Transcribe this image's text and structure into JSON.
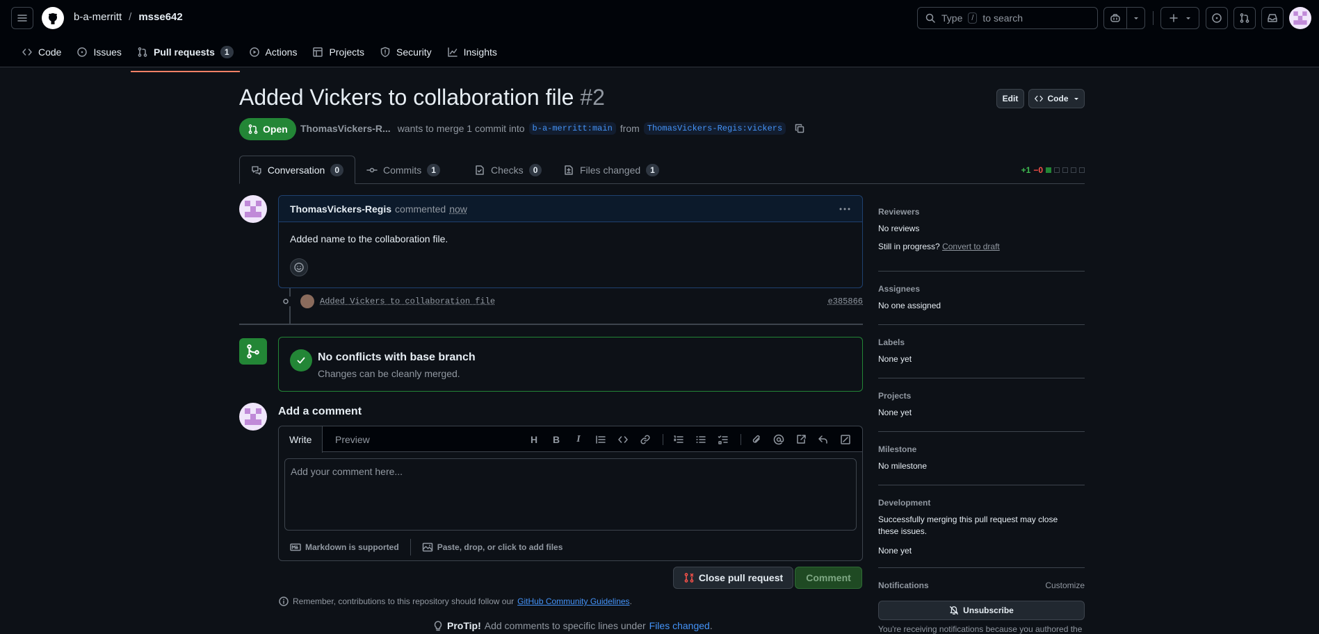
{
  "header": {
    "owner": "b-a-merritt",
    "separator": "/",
    "repo": "msse642",
    "search_placeholder": "Type",
    "search_key": "/",
    "search_suffix": "to search"
  },
  "repo_nav": [
    {
      "label": "Code",
      "icon": "code-icon"
    },
    {
      "label": "Issues",
      "icon": "issue-icon"
    },
    {
      "label": "Pull requests",
      "icon": "pull-request-icon",
      "count": "1",
      "active": true
    },
    {
      "label": "Actions",
      "icon": "play-icon"
    },
    {
      "label": "Projects",
      "icon": "table-icon"
    },
    {
      "label": "Security",
      "icon": "shield-icon"
    },
    {
      "label": "Insights",
      "icon": "graph-icon"
    }
  ],
  "pr": {
    "title": "Added Vickers to collaboration file",
    "number": "#2",
    "edit_label": "Edit",
    "code_label": "Code",
    "state": "Open",
    "author_short": "ThomasVickers-R...",
    "merge_text": "wants to merge 1 commit into",
    "base_branch": "b-a-merritt:main",
    "from_text": "from",
    "head_branch": "ThomasVickers-Regis:vickers"
  },
  "tabs": {
    "conversation": {
      "label": "Conversation",
      "count": "0"
    },
    "commits": {
      "label": "Commits",
      "count": "1"
    },
    "checks": {
      "label": "Checks",
      "count": "0"
    },
    "files": {
      "label": "Files changed",
      "count": "1"
    }
  },
  "diffstat": {
    "add": "+1",
    "del": "−0"
  },
  "comment": {
    "author": "ThomasVickers-Regis",
    "action": "commented",
    "time": "now",
    "body": "Added name to the collaboration file."
  },
  "commit": {
    "message": "Added Vickers to collaboration file",
    "sha": "e385866"
  },
  "merge": {
    "title": "No conflicts with base branch",
    "subtitle": "Changes can be cleanly merged."
  },
  "editor": {
    "heading": "Add a comment",
    "write_tab": "Write",
    "preview_tab": "Preview",
    "placeholder": "Add your comment here...",
    "markdown": "Markdown is supported",
    "attach": "Paste, drop, or click to add files"
  },
  "actions": {
    "close": "Close pull request",
    "comment": "Comment"
  },
  "footer": {
    "remember": "Remember, contributions to this repository should follow our",
    "guidelines": "GitHub Community Guidelines",
    "period": ".",
    "protip_label": "ProTip!",
    "protip_text": "Add comments to specific lines under",
    "protip_link": "Files changed",
    "protip_end": "."
  },
  "sidebar": {
    "reviewers": {
      "label": "Reviewers",
      "value": "No reviews",
      "progress": "Still in progress?",
      "draft_link": "Convert to draft"
    },
    "assignees": {
      "label": "Assignees",
      "value": "No one assigned"
    },
    "labels": {
      "label": "Labels",
      "value": "None yet"
    },
    "projects": {
      "label": "Projects",
      "value": "None yet"
    },
    "milestone": {
      "label": "Milestone",
      "value": "No milestone"
    },
    "development": {
      "label": "Development",
      "text": "Successfully merging this pull request may close these issues.",
      "value": "None yet"
    },
    "notifications": {
      "label": "Notifications",
      "customize": "Customize",
      "unsubscribe": "Unsubscribe",
      "reason": "You're receiving notifications because you authored the"
    }
  },
  "colors": {
    "accent": "#4493f8",
    "success": "#238636",
    "danger": "#f85149",
    "nav_underline": "#f78166"
  }
}
